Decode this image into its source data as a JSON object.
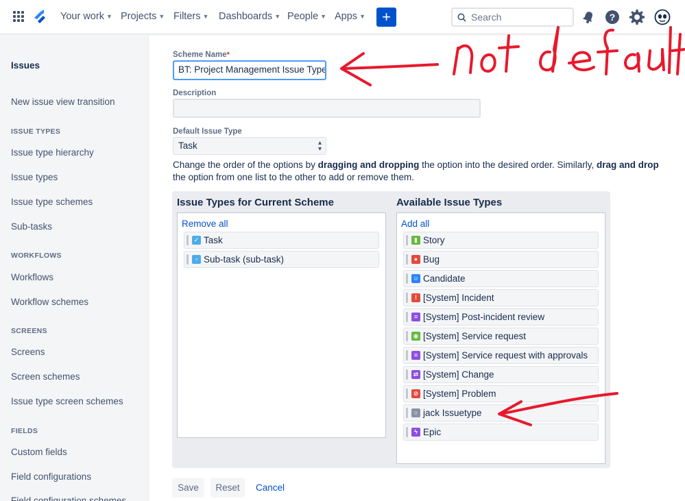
{
  "nav": {
    "items": [
      {
        "label": "Your work"
      },
      {
        "label": "Projects"
      },
      {
        "label": "Filters"
      },
      {
        "label": "Dashboards"
      },
      {
        "label": "People"
      },
      {
        "label": "Apps"
      }
    ],
    "create_label": "+",
    "search_placeholder": "Search",
    "icons": [
      "app-switcher-icon",
      "jira-logo-icon",
      "notifications-icon",
      "help-icon",
      "settings-icon",
      "profile-avatar-icon"
    ]
  },
  "sidebar": {
    "title": "Issues",
    "top_items": [
      {
        "label": "New issue view transition"
      }
    ],
    "sections": [
      {
        "heading": "ISSUE TYPES",
        "items": [
          {
            "label": "Issue type hierarchy"
          },
          {
            "label": "Issue types"
          },
          {
            "label": "Issue type schemes"
          },
          {
            "label": "Sub-tasks"
          }
        ]
      },
      {
        "heading": "WORKFLOWS",
        "items": [
          {
            "label": "Workflows"
          },
          {
            "label": "Workflow schemes"
          }
        ]
      },
      {
        "heading": "SCREENS",
        "items": [
          {
            "label": "Screens"
          },
          {
            "label": "Screen schemes"
          },
          {
            "label": "Issue type screen schemes"
          }
        ]
      },
      {
        "heading": "FIELDS",
        "items": [
          {
            "label": "Custom fields"
          },
          {
            "label": "Field configurations"
          },
          {
            "label": "Field configuration schemes"
          }
        ]
      }
    ]
  },
  "form": {
    "scheme_name_label": "Scheme Name",
    "required_mark": "*",
    "scheme_name_value": "BT: Project Management Issue Type",
    "description_label": "Description",
    "description_value": "",
    "default_type_label": "Default Issue Type",
    "default_type_value": "Task",
    "help_parts": [
      "Change the order of the options by ",
      "dragging and dropping",
      " the option into the desired order. Similarly, ",
      "drag and drop",
      " the option from one list to the other to add or remove them."
    ]
  },
  "current_list": {
    "title": "Issue Types for Current Scheme",
    "action": "Remove all",
    "items": [
      {
        "label": "Task",
        "icon": "task-icon",
        "color": "#4bade8"
      },
      {
        "label": "Sub-task (sub-task)",
        "icon": "subtask-icon",
        "color": "#4bade8"
      }
    ]
  },
  "available_list": {
    "title": "Available Issue Types",
    "action": "Add all",
    "items": [
      {
        "label": "Story",
        "icon": "story-icon",
        "color": "#63ba3c"
      },
      {
        "label": "Bug",
        "icon": "bug-icon",
        "color": "#e5493a"
      },
      {
        "label": "Candidate",
        "icon": "candidate-icon",
        "color": "#2684ff"
      },
      {
        "label": "[System] Incident",
        "icon": "incident-icon",
        "color": "#e5493a"
      },
      {
        "label": "[System] Post-incident review",
        "icon": "review-icon",
        "color": "#904ee2"
      },
      {
        "label": "[System] Service request",
        "icon": "service-request-icon",
        "color": "#63ba3c"
      },
      {
        "label": "[System] Service request with approvals",
        "icon": "approvals-icon",
        "color": "#904ee2"
      },
      {
        "label": "[System] Change",
        "icon": "change-icon",
        "color": "#904ee2"
      },
      {
        "label": "[System] Problem",
        "icon": "problem-icon",
        "color": "#e5493a"
      },
      {
        "label": "jack Issuetype",
        "icon": "generic-issue-icon",
        "color": "#8993a4"
      },
      {
        "label": "Epic",
        "icon": "epic-icon",
        "color": "#904ee2"
      }
    ]
  },
  "buttons": {
    "save": "Save",
    "reset": "Reset",
    "cancel": "Cancel"
  },
  "annotations": {
    "handwritten_note": "not default",
    "ink_color": "#e8192c"
  }
}
